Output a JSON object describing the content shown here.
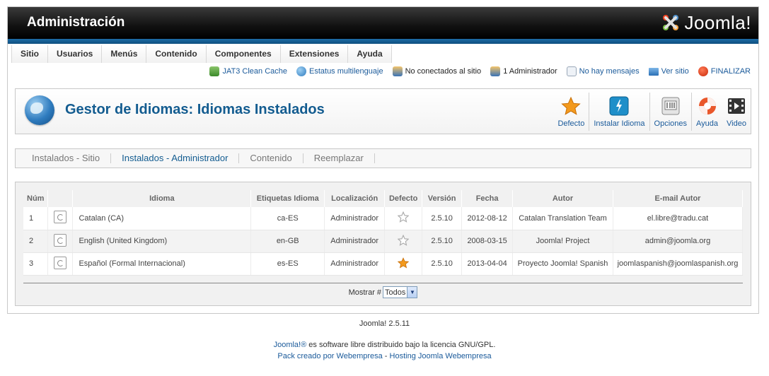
{
  "header": {
    "title": "Administración",
    "logo_text": "Joomla!"
  },
  "menu": [
    "Sitio",
    "Usuarios",
    "Menús",
    "Contenido",
    "Componentes",
    "Extensiones",
    "Ayuda"
  ],
  "status": {
    "cache": "JAT3 Clean Cache",
    "multilang": "Estatus multilenguaje",
    "offline": "No conectados al sitio",
    "admins": "1 Administrador",
    "messages": "No hay mensajes",
    "view_site": "Ver sitio",
    "logout": "FINALIZAR"
  },
  "toolbar": {
    "page_title": "Gestor de Idiomas: Idiomas Instalados",
    "buttons": {
      "default": "Defecto",
      "install": "Instalar Idioma",
      "options": "Opciones",
      "help": "Ayuda",
      "video": "Video"
    }
  },
  "subtabs": [
    "Instalados - Sitio",
    "Instalados - Administrador",
    "Contenido",
    "Reemplazar"
  ],
  "active_subtab": "Instalados - Administrador",
  "table": {
    "headers": [
      "Núm",
      "",
      "Idioma",
      "Etiquetas Idioma",
      "Localización",
      "Defecto",
      "Versión",
      "Fecha",
      "Autor",
      "E-mail Autor"
    ],
    "rows": [
      {
        "num": "1",
        "language": "Catalan (CA)",
        "tag": "ca-ES",
        "location": "Administrador",
        "default": false,
        "version": "2.5.10",
        "date": "2012-08-12",
        "author": "Catalan Translation Team",
        "email": "el.libre@tradu.cat"
      },
      {
        "num": "2",
        "language": "English (United Kingdom)",
        "tag": "en-GB",
        "location": "Administrador",
        "default": false,
        "version": "2.5.10",
        "date": "2008-03-15",
        "author": "Joomla! Project",
        "email": "admin@joomla.org"
      },
      {
        "num": "3",
        "language": "Español (Formal Internacional)",
        "tag": "es-ES",
        "location": "Administrador",
        "default": true,
        "version": "2.5.10",
        "date": "2013-04-04",
        "author": "Proyecto Joomla! Spanish",
        "email": "joomlaspanish@joomlaspanish.org"
      }
    ],
    "limit_label": "Mostrar #",
    "limit_value": "Todos"
  },
  "footer": {
    "version": "Joomla! 2.5.11",
    "license_link": "Joomla!®",
    "license_text": " es software libre distribuido bajo la licencia GNU/GPL.",
    "pack_text": "Pack creado por Webempresa",
    "separator": " - ",
    "hosting_text": "Hosting Joomla Webempresa"
  },
  "colors": {
    "accent": "#135c90",
    "header_bg": "#111111",
    "star_on": "#f39a1e"
  }
}
